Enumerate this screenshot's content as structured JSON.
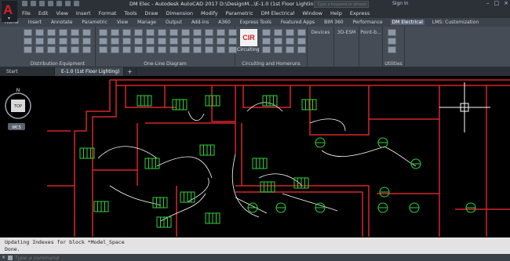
{
  "window": {
    "title": "DM Elec - Autodesk AutoCAD 2017   D:\\DesignM...\\E-1.0 (1st Floor Lighting).dwg",
    "search_placeholder": "Type a keyword or phrase",
    "signin": "Sign In"
  },
  "menu": [
    "File",
    "Edit",
    "View",
    "Insert",
    "Format",
    "Tools",
    "Draw",
    "Dimension",
    "Modify",
    "Parametric",
    "DM Electrical",
    "Window",
    "Help",
    "Express"
  ],
  "ribbon_tabs": [
    "Home",
    "Insert",
    "Annotate",
    "Parametric",
    "View",
    "Manage",
    "Output",
    "Add-ins",
    "A360",
    "Express Tools",
    "Featured Apps",
    "BIM 360",
    "Performance",
    "DM Electrical",
    "LMS: Customization"
  ],
  "active_ribbon_tab": "DM Electrical",
  "ribbon_panels": {
    "distribution": "Distribution Equipment",
    "oneline": "One-Line Diagram",
    "circuiting": "Circuiting and Homeruns",
    "devices": "Devices",
    "esm": "3D-ESM",
    "pointb": "Point-b...",
    "utilities": "Utilities",
    "cir_label": "Circuiting",
    "cir_button": "CIR"
  },
  "doc_tabs": {
    "start": "Start",
    "drawing": "E-1.0 (1st Floor Lighting)",
    "plus": "+"
  },
  "viewcube": {
    "north": "N",
    "top": "TOP",
    "wcs": "WCS"
  },
  "command": {
    "line1": "Updating Indexes for block *Model_Space",
    "line2": "Done.",
    "placeholder": "Type a command"
  },
  "colors": {
    "walls": "#d6262b",
    "fixtures": "#2fd33a",
    "wires": "#ffffff",
    "canvas": "#000000"
  }
}
